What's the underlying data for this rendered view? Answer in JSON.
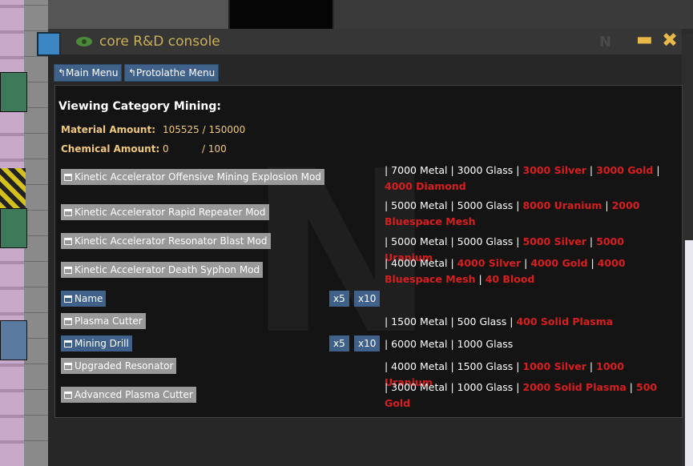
{
  "window": {
    "title": "core R&D console",
    "brand": "N",
    "minimize_icon": "minimize-icon",
    "close_icon": "close-icon"
  },
  "nav": {
    "main_menu": "↰Main Menu",
    "protolathe_menu": "↰Protolathe Menu"
  },
  "category": {
    "heading": "Viewing Category Mining:",
    "material_label": "Material Amount:",
    "material_value": "105525 / 150000",
    "chemical_label": "Chemical Amount:",
    "chemical_value": "0",
    "chemical_max": "/ 100"
  },
  "items": [
    {
      "name": "Kinetic Accelerator Offensive Mining Explosion Mod",
      "cost": [
        [
          "| 7000 Metal | 3000 Glass | ",
          false
        ],
        [
          "3000 Silver",
          true
        ],
        [
          " | ",
          false
        ],
        [
          "3000 Gold",
          true
        ],
        [
          " | ",
          false
        ],
        [
          "4000 Diamond",
          true
        ]
      ]
    },
    {
      "name": "Kinetic Accelerator Rapid Repeater Mod",
      "cost": [
        [
          "| 5000 Metal | 5000 Glass | ",
          false
        ],
        [
          "8000 Uranium",
          true
        ],
        [
          " | ",
          false
        ],
        [
          "2000 Bluespace Mesh",
          true
        ]
      ]
    },
    {
      "name": "Kinetic Accelerator Resonator Blast Mod",
      "cost": [
        [
          "| 5000 Metal | 5000 Glass | ",
          false
        ],
        [
          "5000 Silver",
          true
        ],
        [
          " | ",
          false
        ],
        [
          "5000 Uranium",
          true
        ]
      ]
    },
    {
      "name": "Kinetic Accelerator Death Syphon Mod",
      "cost": [
        [
          "| 4000 Metal | ",
          false
        ],
        [
          "4000 Silver",
          true
        ],
        [
          " | ",
          false
        ],
        [
          "4000 Gold",
          true
        ],
        [
          " | ",
          false
        ],
        [
          "4000 Bluespace Mesh",
          true
        ],
        [
          " | ",
          false
        ],
        [
          "40 Blood",
          true
        ]
      ]
    },
    {
      "name": "Name",
      "cost": []
    },
    {
      "name": "Plasma Cutter",
      "cost": [
        [
          "| 1500 Metal | 500 Glass | ",
          false
        ],
        [
          "400 Solid Plasma",
          true
        ]
      ]
    },
    {
      "name": "Mining Drill",
      "cost": [
        [
          "| 6000 Metal | 1000 Glass",
          false
        ]
      ]
    },
    {
      "name": "Upgraded Resonator",
      "cost": [
        [
          "| 4000 Metal | 1500 Glass | ",
          false
        ],
        [
          "1000 Silver",
          true
        ],
        [
          " | ",
          false
        ],
        [
          "1000 Uranium",
          true
        ]
      ]
    },
    {
      "name": "Advanced Plasma Cutter",
      "cost": [
        [
          "| 3000 Metal | 1000 Glass | ",
          false
        ],
        [
          "2000 Solid Plasma",
          true
        ],
        [
          " | ",
          false
        ],
        [
          "500 Gold",
          true
        ]
      ]
    }
  ],
  "multipliers": {
    "x5": "x5",
    "x10": "x10"
  },
  "colors": {
    "accent_blue": "#40628a",
    "disabled_grey": "#999999",
    "scarce_red": "#d81e1e",
    "label_gold": "#f0c87a"
  }
}
